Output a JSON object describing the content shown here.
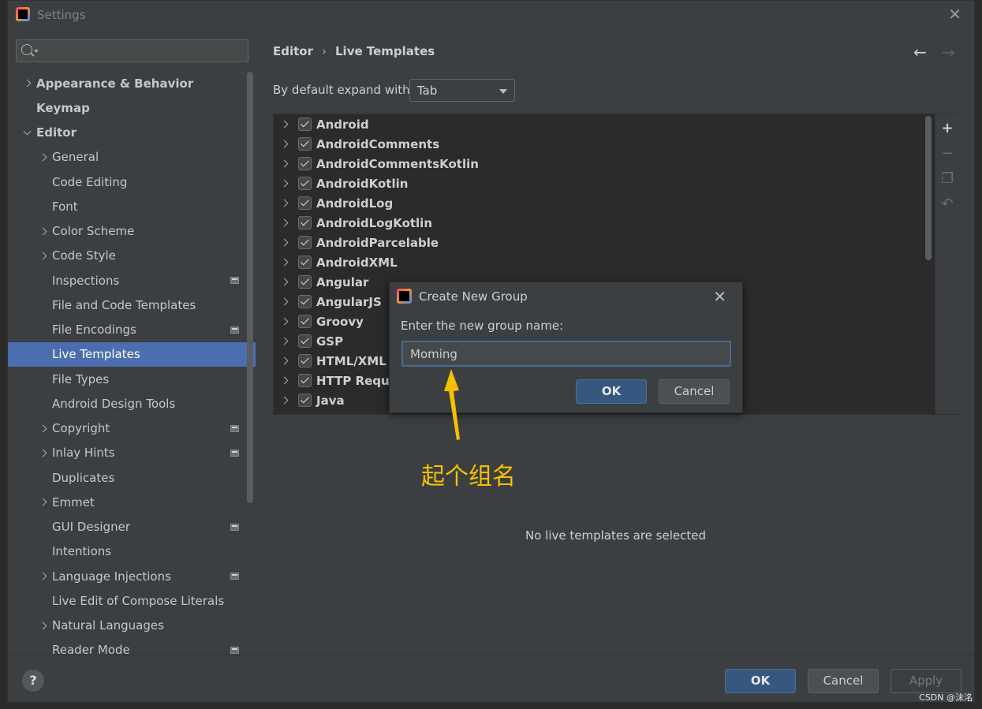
{
  "window": {
    "title": "Settings"
  },
  "search": {
    "placeholder": ""
  },
  "sidebar": {
    "items": [
      {
        "label": "Appearance & Behavior",
        "bold": true,
        "chevron": "right",
        "indent": 0,
        "icon": false
      },
      {
        "label": "Keymap",
        "bold": true,
        "chevron": "none",
        "indent": 0,
        "icon": false
      },
      {
        "label": "Editor",
        "bold": true,
        "chevron": "down",
        "indent": 0,
        "icon": false
      },
      {
        "label": "General",
        "bold": false,
        "chevron": "right",
        "indent": 1,
        "icon": false
      },
      {
        "label": "Code Editing",
        "bold": false,
        "chevron": "none",
        "indent": 1,
        "icon": false
      },
      {
        "label": "Font",
        "bold": false,
        "chevron": "none",
        "indent": 1,
        "icon": false
      },
      {
        "label": "Color Scheme",
        "bold": false,
        "chevron": "right",
        "indent": 1,
        "icon": false
      },
      {
        "label": "Code Style",
        "bold": false,
        "chevron": "right",
        "indent": 1,
        "icon": false
      },
      {
        "label": "Inspections",
        "bold": false,
        "chevron": "none",
        "indent": 1,
        "icon": true
      },
      {
        "label": "File and Code Templates",
        "bold": false,
        "chevron": "none",
        "indent": 1,
        "icon": false
      },
      {
        "label": "File Encodings",
        "bold": false,
        "chevron": "none",
        "indent": 1,
        "icon": true
      },
      {
        "label": "Live Templates",
        "bold": false,
        "chevron": "none",
        "indent": 1,
        "icon": false,
        "selected": true
      },
      {
        "label": "File Types",
        "bold": false,
        "chevron": "none",
        "indent": 1,
        "icon": false
      },
      {
        "label": "Android Design Tools",
        "bold": false,
        "chevron": "none",
        "indent": 1,
        "icon": false
      },
      {
        "label": "Copyright",
        "bold": false,
        "chevron": "right",
        "indent": 1,
        "icon": true
      },
      {
        "label": "Inlay Hints",
        "bold": false,
        "chevron": "right",
        "indent": 1,
        "icon": true
      },
      {
        "label": "Duplicates",
        "bold": false,
        "chevron": "none",
        "indent": 1,
        "icon": false
      },
      {
        "label": "Emmet",
        "bold": false,
        "chevron": "right",
        "indent": 1,
        "icon": false
      },
      {
        "label": "GUI Designer",
        "bold": false,
        "chevron": "none",
        "indent": 1,
        "icon": true
      },
      {
        "label": "Intentions",
        "bold": false,
        "chevron": "none",
        "indent": 1,
        "icon": false
      },
      {
        "label": "Language Injections",
        "bold": false,
        "chevron": "right",
        "indent": 1,
        "icon": true
      },
      {
        "label": "Live Edit of Compose Literals",
        "bold": false,
        "chevron": "none",
        "indent": 1,
        "icon": false
      },
      {
        "label": "Natural Languages",
        "bold": false,
        "chevron": "right",
        "indent": 1,
        "icon": false
      },
      {
        "label": "Reader Mode",
        "bold": false,
        "chevron": "none",
        "indent": 1,
        "icon": true
      }
    ]
  },
  "breadcrumb": {
    "root": "Editor",
    "separator": "›",
    "current": "Live Templates"
  },
  "expand": {
    "label": "By default expand with",
    "value": "Tab"
  },
  "templates": [
    "Android",
    "AndroidComments",
    "AndroidCommentsKotlin",
    "AndroidKotlin",
    "AndroidLog",
    "AndroidLogKotlin",
    "AndroidParcelable",
    "AndroidXML",
    "Angular",
    "AngularJS",
    "Groovy",
    "GSP",
    "HTML/XML",
    "HTTP Reque",
    "Java"
  ],
  "empty_message": "No live templates are selected",
  "footer": {
    "ok": "OK",
    "cancel": "Cancel",
    "apply": "Apply",
    "help": "?"
  },
  "dialog": {
    "title": "Create New Group",
    "prompt": "Enter the new group name:",
    "value": "Moming",
    "ok": "OK",
    "cancel": "Cancel"
  },
  "annotation": {
    "text": "起个组名",
    "color": "#f5c000"
  },
  "watermark": "CSDN @沫洺",
  "colors": {
    "selection": "#4b6eaf",
    "primary_button": "#365880",
    "background": "#3c3f41"
  }
}
